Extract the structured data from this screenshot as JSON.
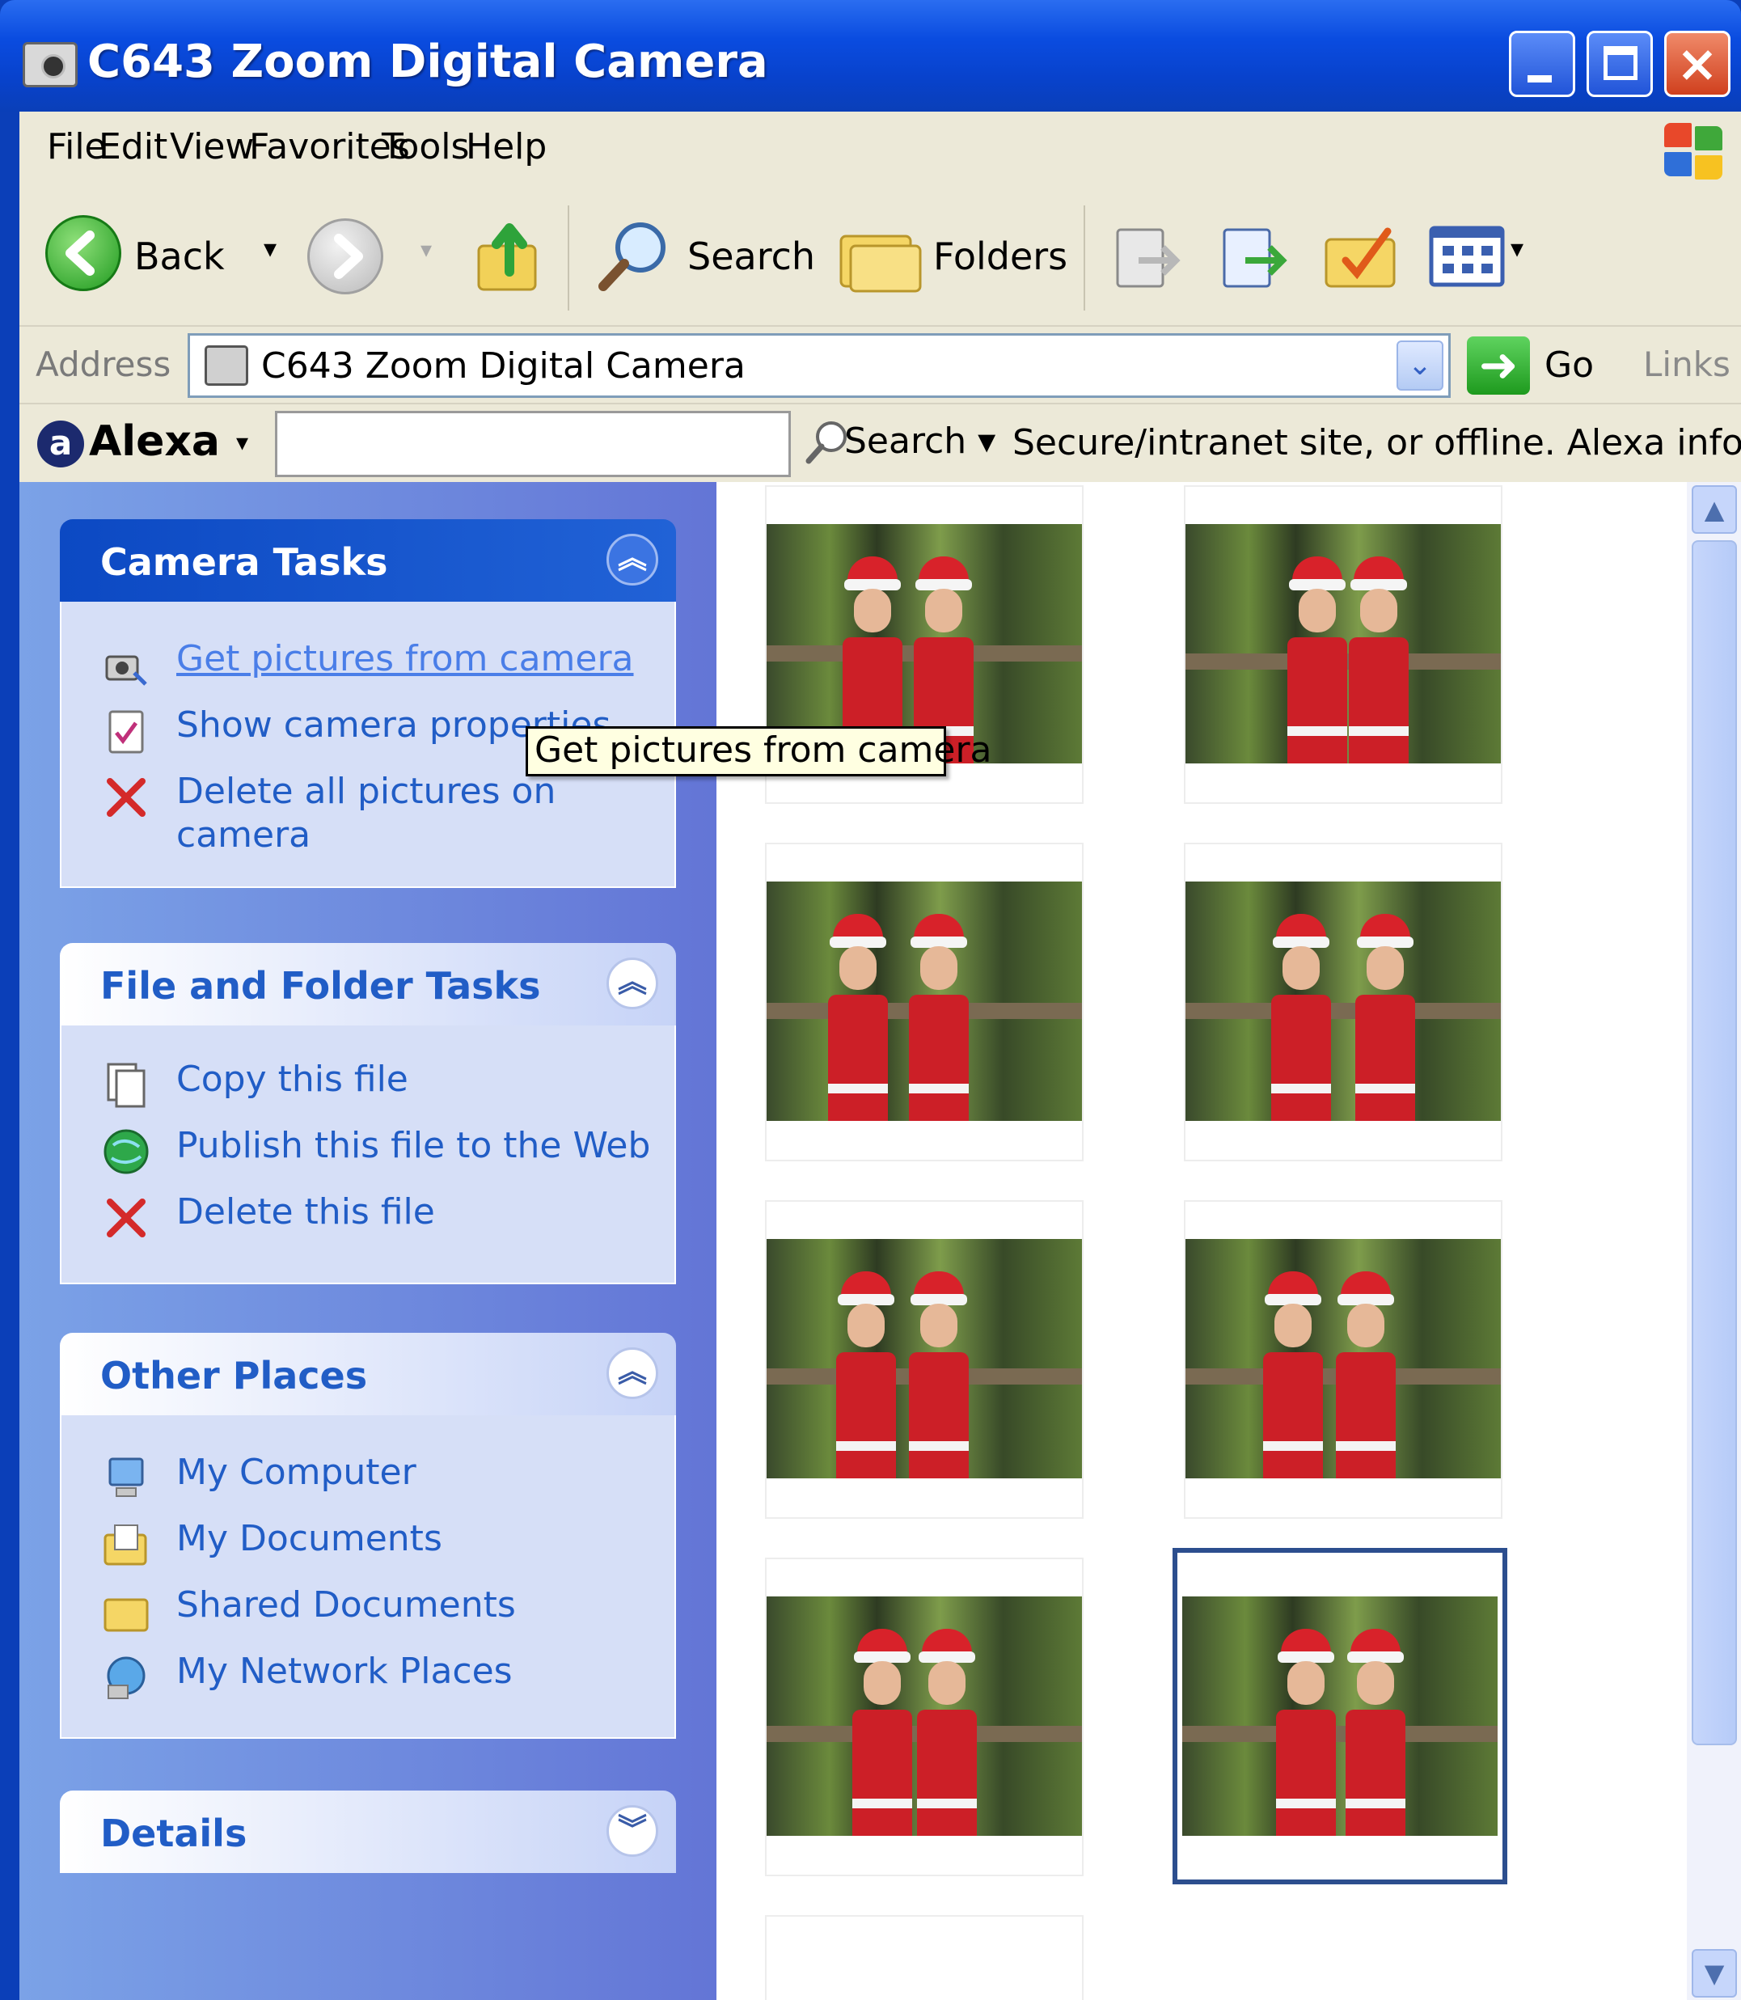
{
  "window": {
    "title": "C643 Zoom Digital Camera",
    "controls": [
      "minimize",
      "maximize",
      "close"
    ]
  },
  "menu": [
    {
      "label": "File"
    },
    {
      "label": "Edit"
    },
    {
      "label": "View"
    },
    {
      "label": "Favorites"
    },
    {
      "label": "Tools"
    },
    {
      "label": "Help"
    }
  ],
  "toolbar": {
    "back_label": "Back",
    "search_label": "Search",
    "folders_label": "Folders"
  },
  "address": {
    "label": "Address",
    "value": "C643 Zoom Digital Camera",
    "go_label": "Go",
    "links_label": "Links"
  },
  "alexa": {
    "name": "Alexa",
    "search_value": "",
    "search_label": "Search",
    "status": "Secure/intranet site, or offline. Alexa info no"
  },
  "panels": {
    "camera_tasks": {
      "title": "Camera Tasks",
      "items": [
        {
          "label": "Get pictures from camera",
          "icon": "camera-wizard-icon"
        },
        {
          "label": "Show camera properties",
          "icon": "properties-icon"
        },
        {
          "label": "Delete all pictures on",
          "label2": "camera",
          "icon": "delete-x-icon"
        }
      ]
    },
    "file_tasks": {
      "title": "File and Folder Tasks",
      "items": [
        {
          "label": "Copy this file",
          "icon": "copy-icon"
        },
        {
          "label": "Publish this file to the Web",
          "icon": "globe-icon"
        },
        {
          "label": "Delete this file",
          "icon": "delete-x-icon"
        }
      ]
    },
    "other_places": {
      "title": "Other Places",
      "items": [
        {
          "label": "My Computer",
          "icon": "my-computer-icon"
        },
        {
          "label": "My Documents",
          "icon": "my-documents-icon"
        },
        {
          "label": "Shared Documents",
          "icon": "folder-icon"
        },
        {
          "label": "My Network Places",
          "icon": "network-icon"
        }
      ]
    },
    "details": {
      "title": "Details"
    }
  },
  "tooltip": "Get pictures from camera",
  "thumbnails": {
    "count_visible": 9,
    "selected_index": 7
  },
  "colors": {
    "titlebar": "#0a4ce0",
    "taskpane": "#6375d6",
    "link": "#215dc6",
    "selection": "#2c4e8e"
  }
}
